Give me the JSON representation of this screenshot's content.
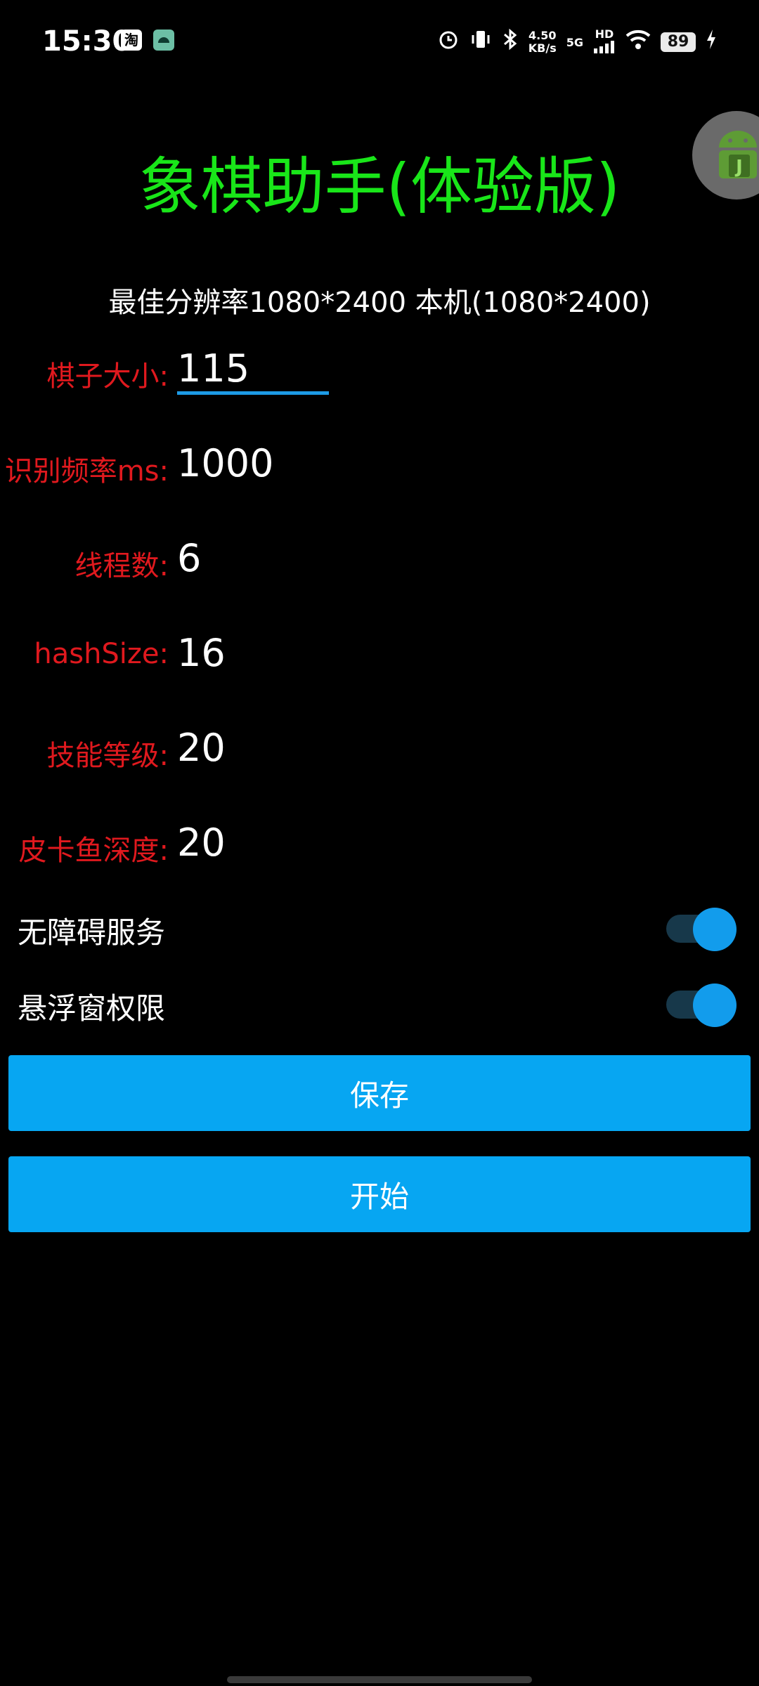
{
  "status_bar": {
    "time": "15:30",
    "notif_icons": [
      "taobao-icon",
      "android-icon"
    ],
    "notif_icon_text": [
      "淘",
      ""
    ],
    "net_speed_top": "4.50",
    "net_speed_bottom": "KB/s",
    "network": "5G",
    "hd": "HD",
    "battery": "89",
    "icons": [
      "alarm-icon",
      "vibrate-icon",
      "bluetooth-icon",
      "signal-icon",
      "wifi-icon",
      "charging-icon"
    ]
  },
  "app": {
    "title": "象棋助手(体验版)",
    "resolution_text": "最佳分辨率1080*2400 本机(1080*2400)"
  },
  "settings": [
    {
      "label": "棋子大小:",
      "value": "115"
    },
    {
      "label": "识别频率ms:",
      "value": "1000"
    },
    {
      "label": "线程数:",
      "value": "6"
    },
    {
      "label": "hashSize:",
      "value": "16"
    },
    {
      "label": "技能等级:",
      "value": "20"
    },
    {
      "label": "皮卡鱼深度:",
      "value": "20"
    }
  ],
  "toggles": [
    {
      "label": "无障碍服务",
      "on": true
    },
    {
      "label": "悬浮窗权限",
      "on": true
    }
  ],
  "buttons": {
    "save": "保存",
    "start": "开始"
  },
  "colors": {
    "title": "#19e619",
    "label": "#e0191e",
    "accent": "#07a6f2"
  }
}
